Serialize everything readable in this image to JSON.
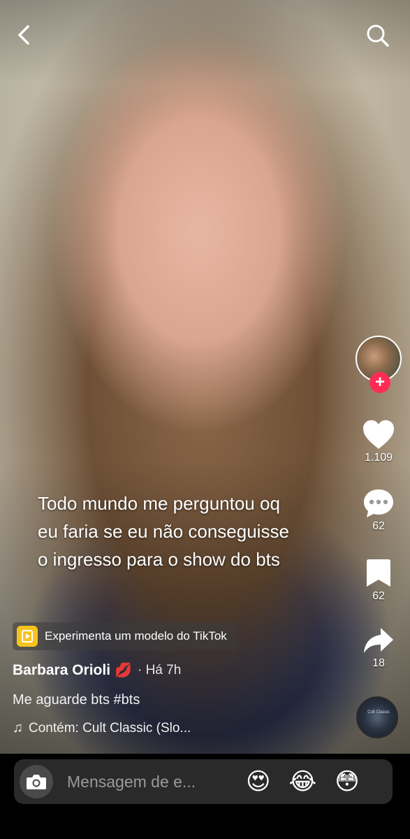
{
  "top_bar": {
    "back_icon": "chevron-left-icon",
    "search_icon": "search-icon"
  },
  "caption": {
    "line1": "Todo mundo me perguntou oq",
    "line2": "eu faria se eu não conseguisse",
    "line3": "o ingresso para o show do bts"
  },
  "side_actions": {
    "follow_symbol": "+",
    "likes": "1.109",
    "comments": "62",
    "saves": "62",
    "shares": "18",
    "disc_label": "Cult Classic"
  },
  "template_pill": {
    "label": "Experimenta um modelo do TikTok"
  },
  "author": {
    "name": "Barbara Orioli",
    "emoji": "💋",
    "time": "· Há 7h"
  },
  "description": "Me aguarde bts #bts",
  "music": {
    "note": "♫",
    "label": "Contém: Cult Classic (Slo..."
  },
  "message_bar": {
    "placeholder": "Mensagem de e...",
    "emojis": [
      "😍",
      "😂",
      "😳"
    ]
  },
  "colors": {
    "follow": "#fe2c55",
    "template_icon": "#f7c31d",
    "bar_bg": "#2a2a2a"
  }
}
